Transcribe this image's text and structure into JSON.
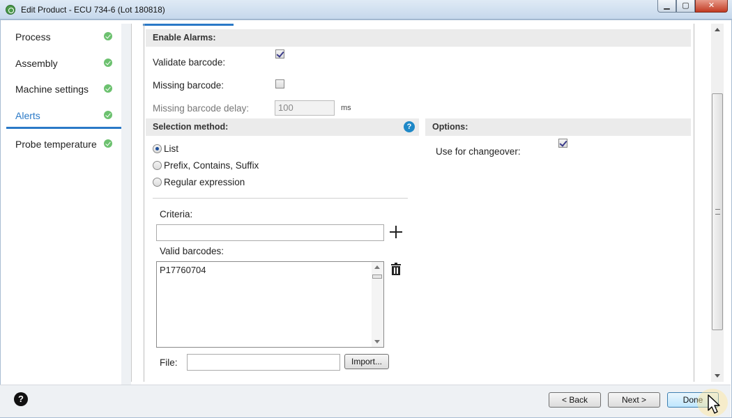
{
  "window": {
    "title": "Edit Product - ECU 734-6 (Lot 180818)",
    "minimize": "▁",
    "maximize": "▢",
    "close": "✕"
  },
  "sidebar": {
    "items": [
      {
        "label": "Process",
        "status": "complete",
        "active": false
      },
      {
        "label": "Assembly",
        "status": "complete",
        "active": false
      },
      {
        "label": "Machine settings",
        "status": "complete",
        "active": false
      },
      {
        "label": "Alerts",
        "status": "complete",
        "active": true
      },
      {
        "label": "Probe temperature",
        "status": "complete",
        "active": false
      }
    ]
  },
  "alarms": {
    "header": "Enable Alarms:",
    "validate_label": "Validate barcode:",
    "validate_checked": true,
    "missing_label": "Missing barcode:",
    "missing_checked": false,
    "delay_label": "Missing barcode delay:",
    "delay_value": "100",
    "delay_unit": "ms"
  },
  "selection": {
    "header": "Selection method:",
    "options": [
      "List",
      "Prefix, Contains, Suffix",
      "Regular expression"
    ],
    "selected": "List",
    "criteria_label": "Criteria:",
    "criteria_value": "",
    "valid_label": "Valid barcodes:",
    "valid_barcodes": [
      "P17760704"
    ],
    "file_label": "File:",
    "file_value": "",
    "import_button": "Import..."
  },
  "options": {
    "header": "Options:",
    "changeover_label": "Use for changeover:",
    "changeover_checked": true
  },
  "footer": {
    "back": "< Back",
    "next": "Next >",
    "done": "Done",
    "help": "?"
  },
  "colors": {
    "accent": "#2a79c7",
    "check": "#6cc16f",
    "help": "#1e88c7"
  }
}
